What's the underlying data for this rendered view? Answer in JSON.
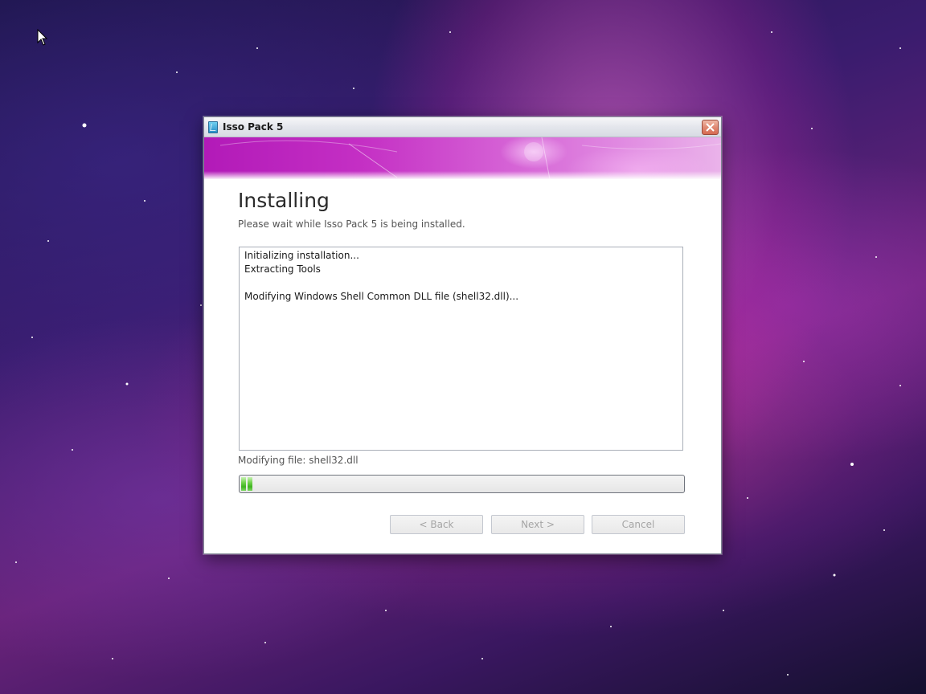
{
  "window": {
    "title": "Isso Pack 5"
  },
  "page": {
    "heading": "Installing",
    "subheading": "Please wait while Isso Pack 5 is being installed."
  },
  "log": {
    "lines": [
      "Initializing installation...",
      "Extracting Tools",
      "",
      "Modifying Windows Shell Common DLL file (shell32.dll)..."
    ]
  },
  "status": {
    "text": "Modifying file: shell32.dll"
  },
  "progress": {
    "fraction": 0.03
  },
  "buttons": {
    "back": "< Back",
    "next": "Next >",
    "cancel": "Cancel"
  },
  "icons": {
    "app": "app-icon",
    "close": "close-icon",
    "cursor": "mouse-cursor-icon"
  },
  "colors": {
    "banner_start": "#b21ab8",
    "banner_end": "#eab3ea",
    "progress_green": "#3fb321"
  }
}
